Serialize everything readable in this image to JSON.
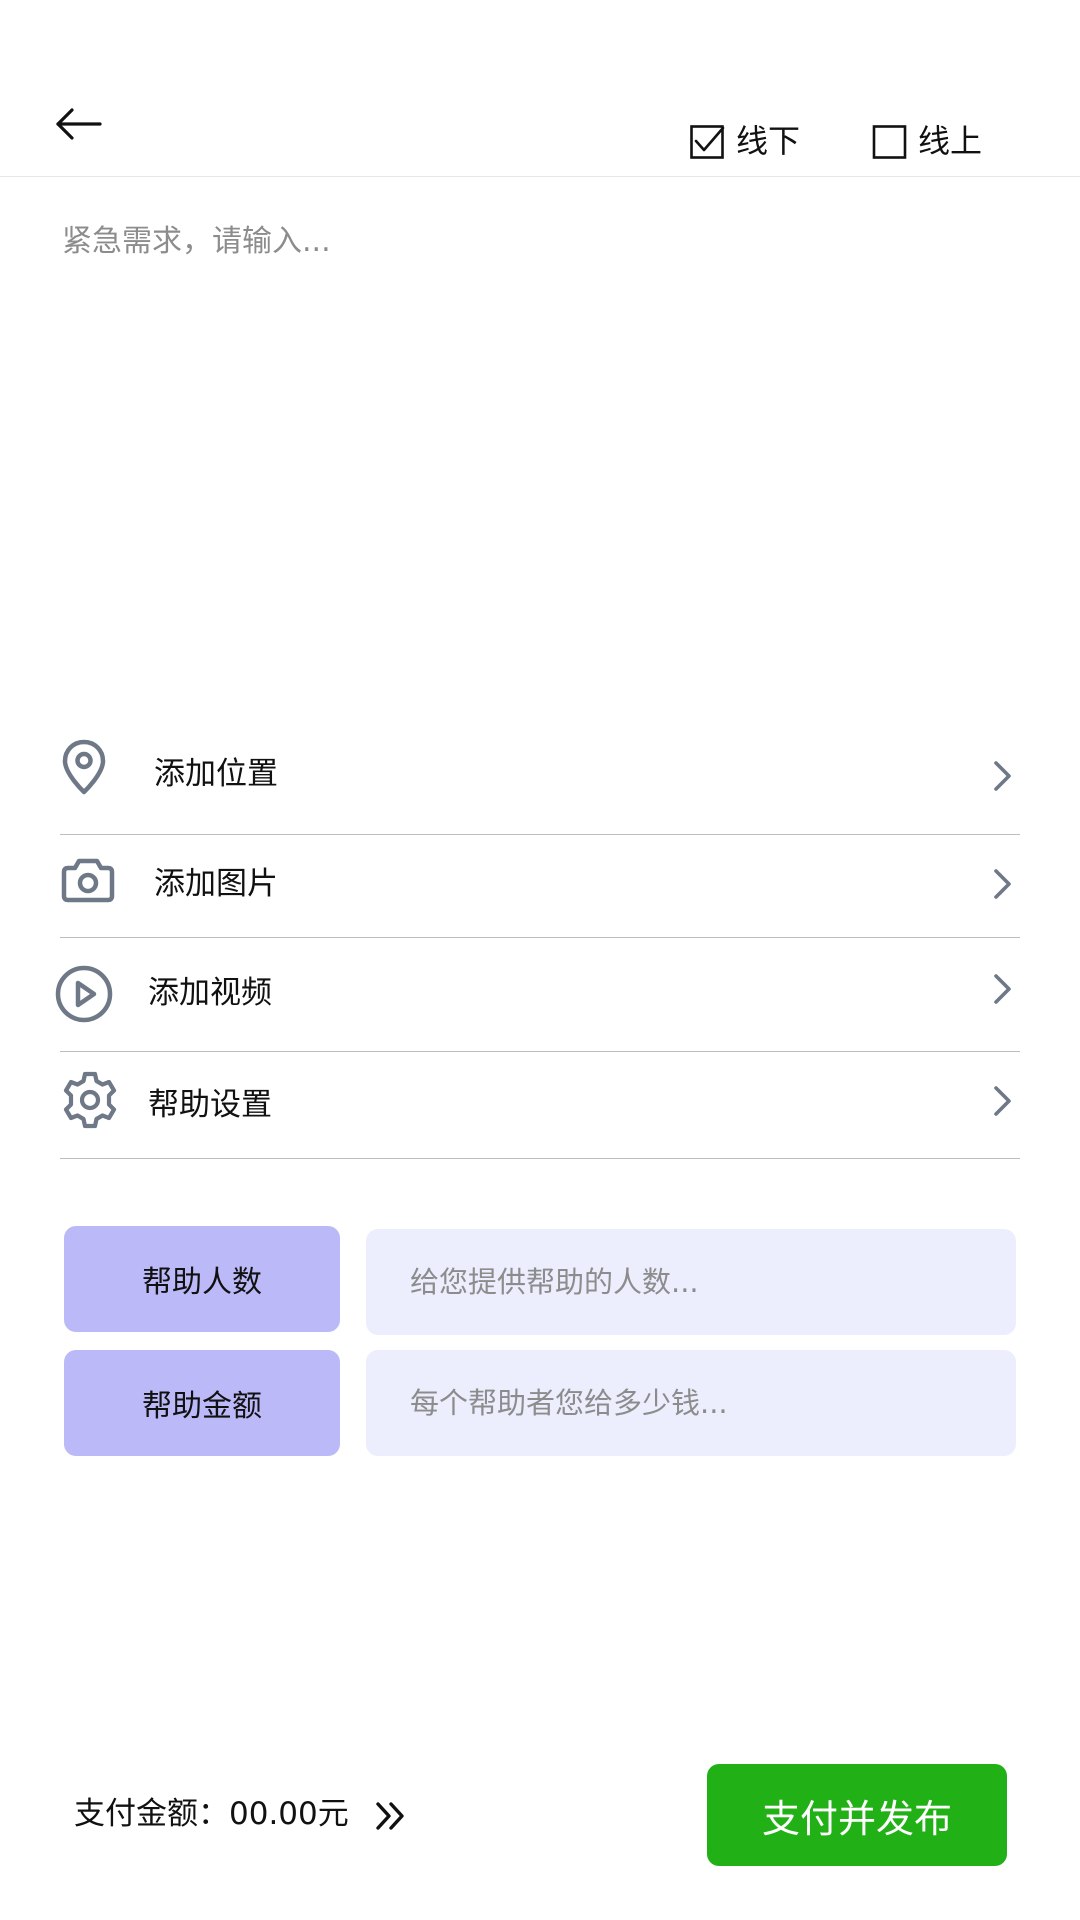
{
  "header": {
    "back_icon": "arrow-left-icon",
    "modes": [
      {
        "label": "线下",
        "checked": true
      },
      {
        "label": "线上",
        "checked": false
      }
    ]
  },
  "request": {
    "value": "",
    "placeholder": "紧急需求，请输入..."
  },
  "options": [
    {
      "label": "添加位置",
      "icon": "location-pin-icon"
    },
    {
      "label": "添加图片",
      "icon": "camera-icon"
    },
    {
      "label": "添加视频",
      "icon": "play-circle-icon"
    },
    {
      "label": "帮助设置",
      "icon": "gear-icon"
    }
  ],
  "help": {
    "people_label": "帮助人数",
    "people_value": "",
    "people_placeholder": "给您提供帮助的人数...",
    "amount_label": "帮助金额",
    "amount_value": "",
    "amount_placeholder": "每个帮助者您给多少钱..."
  },
  "footer": {
    "pay_text": "支付金额：00.00元",
    "expand_icon": "double-chevron-right-icon",
    "publish_label": "支付并发布"
  },
  "colors": {
    "primary_green": "#21b116",
    "label_purple": "#bcb9f8",
    "input_lavender": "#eceefe",
    "icon_slate": "#6e7887"
  }
}
